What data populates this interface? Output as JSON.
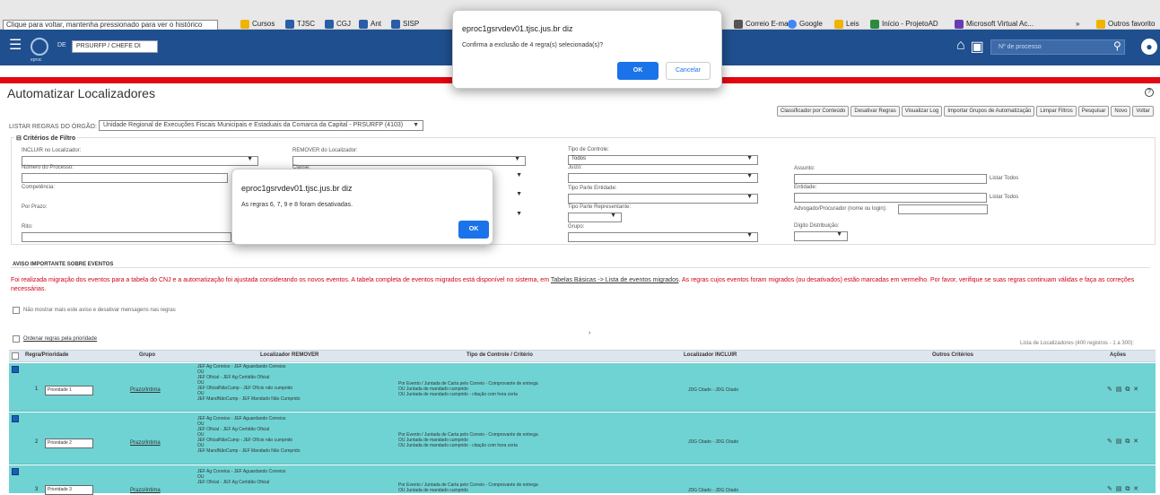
{
  "browser": {
    "back_tooltip": "Clique para voltar, mantenha pressionado para ver o histórico",
    "bookmarks": [
      {
        "label": "Cursos",
        "color": "#f0b400"
      },
      {
        "label": "TJSC",
        "color": "#2b5ca8"
      },
      {
        "label": "CGJ",
        "color": "#2b5ca8"
      },
      {
        "label": "Ant",
        "color": "#2b5ca8"
      },
      {
        "label": "SISP",
        "color": "#2b5ca8"
      }
    ],
    "bookmarks_right": [
      {
        "label": "Correio E-mail",
        "color": "#555555"
      },
      {
        "label": "Google",
        "color": "#4285f4"
      },
      {
        "label": "Leis",
        "color": "#f0b400"
      },
      {
        "label": "Início - ProjetoAD",
        "color": "#2b8a3e"
      },
      {
        "label": "Microsoft Virtual Ac...",
        "color": "#6a3ab2"
      }
    ],
    "more": "»",
    "other_favorites": "Outros favorito"
  },
  "header": {
    "org_label": "DE",
    "org_selected": "PRSURFP / CHEFE DI",
    "process_placeholder": "Nº de processo",
    "logo_text": "eproc"
  },
  "page": {
    "title": "Automatizar Localizadores",
    "listar_label": "LISTAR REGRAS DO ÓRGÃO:",
    "listar_value": "Unidade Regional de Execuções Fiscais Municipais e Estaduais da Comarca da Capital - PRSURFP (4103)"
  },
  "buttons": [
    "Classificador por Conteúdo",
    "Desativar Regras",
    "Visualizar Log",
    "Importar Grupos de Automatização",
    "Limpar Filtros",
    "Pesquisar",
    "Novo",
    "Voltar"
  ],
  "filters": {
    "legend": "Critérios de Filtro",
    "incluir_label": "INCLUIR no Localizador:",
    "remover_label": "REMOVER do Localizador:",
    "tipo_controle_label": "Tipo de Controle:",
    "tipo_controle_value": "Todos",
    "numero_label": "Número do Processo:",
    "classe_label": "Classe:",
    "juizo_label": "Juízo:",
    "assunto_label": "Assunto:",
    "listar_todos_1": "Listar Todos",
    "competencia_label": "Competência:",
    "tipo_parte_entidade_label": "Tipo Parte Entidade:",
    "entidade_label": "Entidade:",
    "listar_todos_2": "Listar Todos",
    "por_prazo_label": "Por Prazo:",
    "tipo_parte_representante_label": "Tipo Parte Representante:",
    "advogado_label": "Advogado/Procurador (nome ou login):",
    "rito_label": "Rito:",
    "grupo_label": "Grupo:",
    "digito_label": "Dígito Distribuição:"
  },
  "aviso": {
    "title": "AVISO IMPORTANTE SOBRE EVENTOS",
    "text_1": "Foi realizada migração dos eventos para a tabela do CNJ e a automatização foi ajustada considerando os novos eventos. A tabela completa de eventos migrados está disponível no sistema, em",
    "link": "Tabelas Básicas -> Lista de eventos migrados",
    "text_2": ". As regras cujos eventos foram migrados (ou desativados) estão marcadas em vermelho. Por favor, verifique se suas regras continuam válidas e faça as correções necessárias.",
    "checkbox_label": "Não mostrar mais este aviso e desativar mensagens nas regras"
  },
  "ordenar": "Ordenar regras pela prioridade",
  "lista_info": "Lista de Localizadores (400 registros - 1 a 300):",
  "table": {
    "headers": {
      "regra": "Regra/Prioridade",
      "grupo": "Grupo",
      "loc_remover": "Localizador REMOVER",
      "tipo": "Tipo de Controle / Critério",
      "loc_incluir": "Localizador INCLUIR",
      "outros": "Outros Critérios",
      "acoes": "Ações"
    },
    "rows": [
      {
        "num": "1",
        "prio": "Prioridade 1",
        "grupo": "Prazo/Intima",
        "remover": "JEF Ag Correios - JEF Aguardando Correios\nOU\nJEF Oficial - JEF Ag Certidão Oficial\nOU\nJEF OficialNãoCump - JEF Ofício não cumprido\nOU\nJEF MandNãoCump - JEF Mandado Não Cumprido",
        "tipo": "Por Evento / Juntada de Carta pelo Correio - Comprovante de entrega\nOU Juntada de mandado cumprido\nOU Juntada de mandado cumprido - citação com hora certa",
        "incluir": "JDG Citado - JDG Citado",
        "acoes": "✎ ▤ ⧉ ✕"
      },
      {
        "num": "2",
        "prio": "Prioridade 2",
        "grupo": "Prazo/Intima",
        "remover": "JEF Ag Correios - JEF Aguardando Correios\nOU\nJEF Oficial - JEF Ag Certidão Oficial\nOU\nJEF OficialNãoCump - JEF Ofício não cumprido\nOU\nJEF MandNãoCump - JEF Mandado Não Cumprido",
        "tipo": "Por Evento / Juntada de Carta pelo Correio - Comprovante de entrega\nOU Juntada de mandado cumprido\nOU Juntada de mandado cumprido - citação com hora certa",
        "incluir": "JDG Citado - JDG Citado",
        "acoes": "✎ ▤ ⧉ ✕"
      },
      {
        "num": "3",
        "prio": "Prioridade 3",
        "grupo": "Prazo/Intima",
        "remover": "JEF Ag Correios - JEF Aguardando Correios\nOU\nJEF Oficial - JEF Ag Certidão Oficial",
        "tipo": "Por Evento / Juntada de Carta pelo Correio - Comprovante de entrega\nOU Juntada de mandado cumprido",
        "incluir": "JDG Citado - JDG Citado",
        "acoes": "✎ ▤ ⧉ ✕"
      }
    ]
  },
  "confirm_dialog": {
    "title": "eproc1gsrvdev01.tjsc.jus.br diz",
    "message": "Confirma a exclusão de 4 regra(s) selecionada(s)?",
    "ok": "OK",
    "cancel": "Cancelar"
  },
  "alert_dialog": {
    "title": "eproc1gsrvdev01.tjsc.jus.br diz",
    "message": "As regras 6, 7, 9 e 8 foram desativadas.",
    "ok": "OK"
  },
  "colors": {
    "header_blue": "#1f4f8e",
    "red_bar": "#e30613",
    "row_highlight": "#6fd3d3",
    "dialog_ok": "#1a73e8",
    "aviso_red": "#d0021b"
  }
}
